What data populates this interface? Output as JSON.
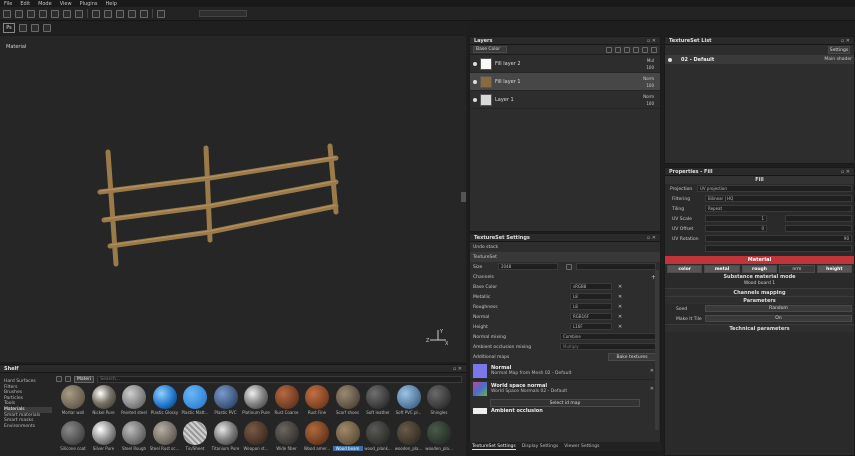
{
  "menu": [
    "File",
    "Edit",
    "Mode",
    "View",
    "Plugins",
    "Help"
  ],
  "toolbar2": {
    "ps_label": "Ps"
  },
  "viewport": {
    "label": "Material"
  },
  "layers": {
    "title": "Layers",
    "channel": "Base Color",
    "items": [
      {
        "name": "Fill layer 2",
        "blend": "Mul",
        "opacity": "100"
      },
      {
        "name": "Fill layer 1",
        "blend": "Norm",
        "opacity": "100"
      },
      {
        "name": "Layer 1",
        "blend": "Norm",
        "opacity": "100"
      }
    ]
  },
  "textureset_settings": {
    "title": "TextureSet Settings",
    "undo": "Undo stack",
    "name": "TextureSet",
    "size_label": "Size",
    "size_value": "2048",
    "channels_label": "Channels",
    "channels": [
      {
        "name": "Base Color",
        "format": "sRGB8"
      },
      {
        "name": "Metallic",
        "format": "L8"
      },
      {
        "name": "Roughness",
        "format": "L8"
      },
      {
        "name": "Normal",
        "format": "RGB16F"
      },
      {
        "name": "Height",
        "format": "L16F"
      }
    ],
    "normal_mixing_label": "Normal mixing",
    "normal_mixing_value": "Combine",
    "ao_mixing_label": "Ambient occlusion mixing",
    "ao_mixing_value": "Multiply",
    "additional_maps": "Additional maps",
    "bake_button": "Bake textures",
    "maps": [
      {
        "title": "Normal",
        "sub": "Normal Map from Mesh 02 - Default"
      },
      {
        "title": "World space normal",
        "sub": "World Space Normals 02 - Default"
      }
    ],
    "select_map": "Select id map",
    "ao_title": "Ambient occlusion"
  },
  "bottom_tabs": [
    "TextureSet Settings",
    "Display Settings",
    "Viewer Settings"
  ],
  "textureset_list": {
    "title": "TextureSet List",
    "settings_button": "Settings",
    "item": "02 - Default",
    "shader": "Main shader"
  },
  "properties": {
    "title": "Properties - Fill",
    "fill_header": "Fill",
    "projection_label": "Projection",
    "projection_value": "UV projection",
    "filtering_label": "Filtering",
    "filtering_value": "Bilinear | HQ",
    "tiling_label": "Tiling",
    "tiling_value": "Repeat",
    "uvscale_label": "UV Scale",
    "uvscale_value": "1",
    "uvoffset_label": "UV Offset",
    "uvoffset_value": "0",
    "uvrot_label": "UV Rotation",
    "uvrot_value": "90",
    "material_header": "Material",
    "mat_toggles": [
      "color",
      "metal",
      "rough",
      "nrm",
      "height"
    ],
    "submat_label": "Substance material mode",
    "submat_value": "Wood board 1",
    "channels_mapping": "Channels mapping",
    "parameters": "Parameters",
    "seed_label": "Seed",
    "seed_value": "Random",
    "tile_label": "Make It Tile",
    "tile_value": "On",
    "technical": "Technical parameters"
  },
  "shelf": {
    "title": "Shelf",
    "search_tag": "Materi",
    "search_placeholder": "Search...",
    "categories": [
      "Hard Surfaces",
      "Filters",
      "Brushes",
      "Particles",
      "Tools",
      "Materials",
      "Smart materials",
      "Smart masks",
      "Environments"
    ],
    "row1": [
      "Mortar wall",
      "Nickel Pure",
      "Painted steel",
      "Plastic Glossy",
      "Plastic Matt...",
      "Plastic PVC",
      "Platinum Pure",
      "Rust Coarse",
      "Rust Fine",
      "Scarf shoes",
      "Soft leather",
      "Soft PVC pl...",
      "Shingles"
    ],
    "row2": [
      "Silicone coat",
      "Silver Pure",
      "Steel Rough",
      "Steel Rust sc...",
      "Tin/Sheet",
      "Titanium Pure",
      "Weapon st...",
      "Wide fiber",
      "Wood amer...",
      "Wood beam",
      "wood_plank...",
      "wooden_pla...",
      "wooden_pla..."
    ]
  },
  "colors": {
    "accent": "#c0343a",
    "selected": "#474747"
  }
}
